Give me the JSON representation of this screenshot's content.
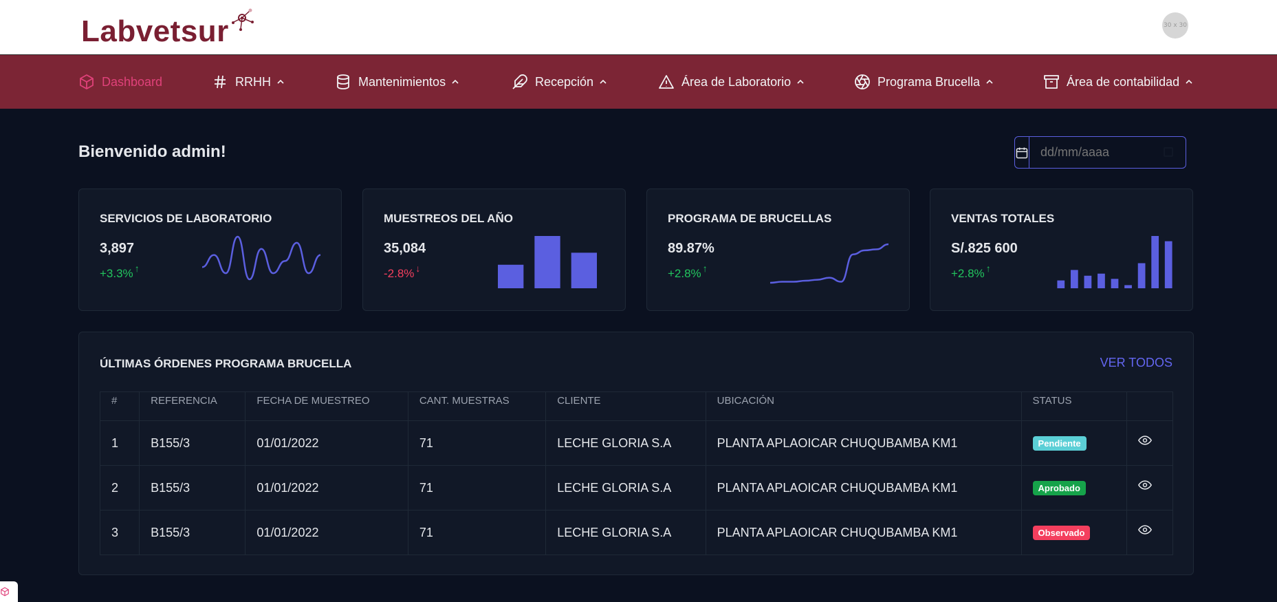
{
  "brand": {
    "name": "Labvetsur"
  },
  "avatar": {
    "text": "30 x 30"
  },
  "nav": [
    {
      "label": "Dashboard",
      "icon": "cube-icon",
      "active": true
    },
    {
      "label": "RRHH",
      "icon": "hash-icon"
    },
    {
      "label": "Mantenimientos",
      "icon": "database-icon"
    },
    {
      "label": "Recepción",
      "icon": "feather-icon"
    },
    {
      "label": "Área de Laboratorio",
      "icon": "alert-triangle-icon"
    },
    {
      "label": "Programa Brucella",
      "icon": "aperture-icon"
    },
    {
      "label": "Área de contabilidad",
      "icon": "archive-icon"
    }
  ],
  "welcome": "Bienvenido admin!",
  "date": {
    "placeholder": "dd/mm/aaaa"
  },
  "cards": [
    {
      "title": "SERVICIOS DE LABORATORIO",
      "value": "3,897",
      "change": "+3.3%",
      "direction": "up"
    },
    {
      "title": "MUESTREOS DEL AÑO",
      "value": "35,084",
      "change": "-2.8%",
      "direction": "down"
    },
    {
      "title": "PROGRAMA DE BRUCELLAS",
      "value": "89.87%",
      "change": "+2.8%",
      "direction": "up"
    },
    {
      "title": "VENTAS TOTALES",
      "value": "S/.825 600",
      "change": "+2.8%",
      "direction": "up"
    }
  ],
  "colors": {
    "accent": "#5b5fe0",
    "up": "#22c55e",
    "down": "#f43f5e",
    "nav_bg": "#7c2535",
    "active_nav": "#e0417a"
  },
  "chart_data": [
    {
      "type": "line",
      "values": [
        3,
        5,
        2,
        8,
        1,
        6,
        2,
        4,
        7,
        2,
        5
      ]
    },
    {
      "type": "bar",
      "values": [
        45,
        100,
        68
      ]
    },
    {
      "type": "line",
      "values": [
        10,
        11,
        11,
        12,
        13,
        15,
        11,
        38,
        42,
        43,
        48
      ]
    },
    {
      "type": "bar",
      "values": [
        15,
        35,
        24,
        28,
        18,
        6,
        48,
        100,
        90
      ]
    }
  ],
  "orders": {
    "title": "ÚLTIMAS ÓRDENES PROGRAMA BRUCELLA",
    "link": "VER TODOS",
    "columns": [
      "#",
      "REFERENCIA",
      "FECHA DE MUESTREO",
      "CANT. MUESTRAS",
      "CLIENTE",
      "UBICACIÓN",
      "STATUS",
      ""
    ],
    "rows": [
      {
        "n": "1",
        "ref": "B155/3",
        "date": "01/01/2022",
        "qty": "71",
        "client": "LECHE GLORIA S.A",
        "location": "PLANTA APLAOICAR CHUQUBAMBA KM1",
        "status": "Pendiente",
        "status_color": "#5bcfd6"
      },
      {
        "n": "2",
        "ref": "B155/3",
        "date": "01/01/2022",
        "qty": "71",
        "client": "LECHE GLORIA S.A",
        "location": "PLANTA APLAOICAR CHUQUBAMBA KM1",
        "status": "Aprobado",
        "status_color": "#16a34a"
      },
      {
        "n": "3",
        "ref": "B155/3",
        "date": "01/01/2022",
        "qty": "71",
        "client": "LECHE GLORIA S.A",
        "location": "PLANTA APLAOICAR CHUQUBAMBA KM1",
        "status": "Observado",
        "status_color": "#f43f5e"
      }
    ]
  }
}
